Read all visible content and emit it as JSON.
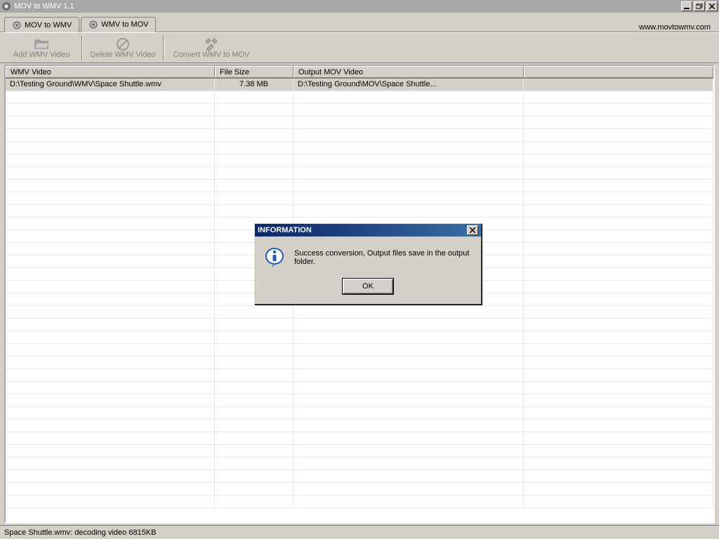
{
  "titlebar": {
    "title": "MOV to WMV 1.1"
  },
  "tabs": [
    {
      "label": "MOV to WMV"
    },
    {
      "label": "WMV to MOV"
    }
  ],
  "url": "www.movtowmv.com",
  "toolbar": {
    "add": "Add WMV Video",
    "delete": "Delete WMV Video",
    "convert": "Convert WMV to MOV"
  },
  "columns": {
    "c1": "WMV Video",
    "c2": "File Size",
    "c3": "Output MOV Video",
    "c4": ""
  },
  "rows": [
    {
      "c1": "D:\\Testing Ground\\WMV\\Space Shuttle.wmv",
      "c2": "7.38 MB",
      "c3": "D:\\Testing Ground\\MOV\\Space Shuttle..."
    }
  ],
  "status": "Space Shuttle.wmv: decoding video 6815KB",
  "dialog": {
    "title": "INFORMATION",
    "message": "Success conversion, Output files save in the output folder.",
    "ok": "OK"
  }
}
